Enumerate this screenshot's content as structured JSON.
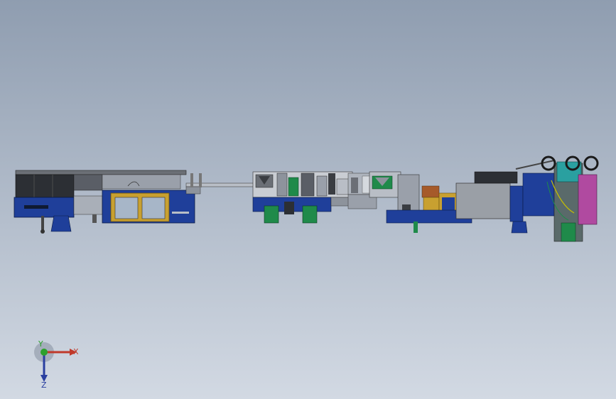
{
  "viewport": {
    "background_top": "#8f9db0",
    "background_bottom": "#d2d9e3"
  },
  "triad": {
    "x_label": "X",
    "y_label": "Y",
    "z_label": "Z",
    "x_color": "#c0392b",
    "y_color": "#2ca02c",
    "z_color": "#2a3fa0"
  },
  "model": {
    "name": "production-line-assembly",
    "colors": {
      "blue_frame": "#1f3f9a",
      "dark_blue": "#0f2a6e",
      "yellow_door": "#c8a030",
      "steel": "#b9bec6",
      "dark_panel": "#2c2f34",
      "green_part": "#1f8a4a",
      "teal_reel": "#2aa0a0",
      "magenta_cabinet": "#b04aa0"
    }
  }
}
